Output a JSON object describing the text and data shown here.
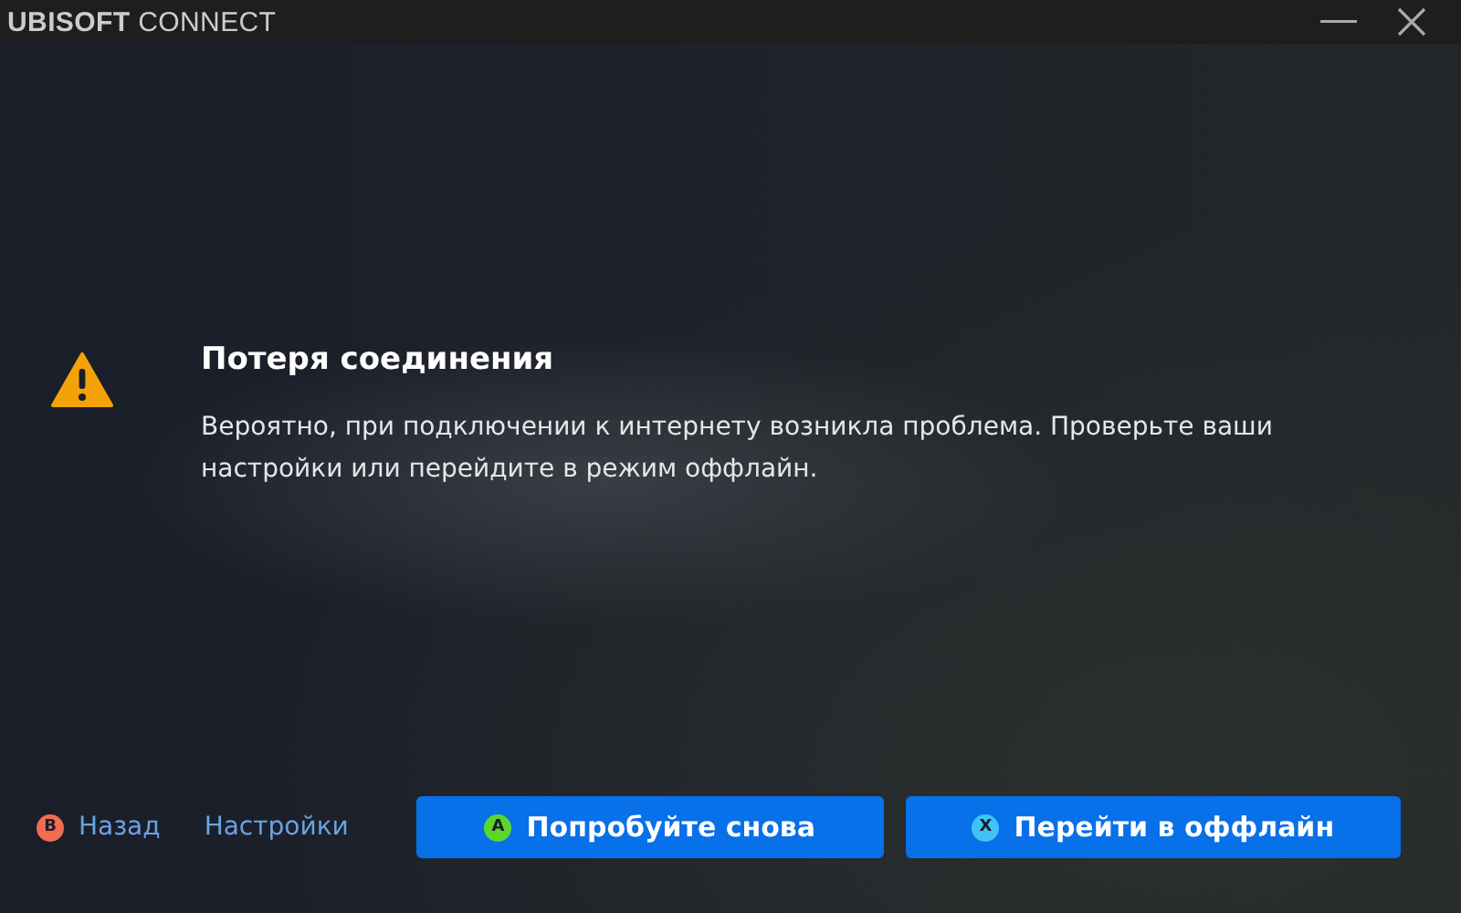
{
  "window": {
    "title_bold": "UBISOFT",
    "title_rest": "CONNECT"
  },
  "dialog": {
    "title": "Потеря соединения",
    "message": "Вероятно, при подключении к интернету возникла проблема. Проверьте ваши настройки или перейдите в режим оффлайн."
  },
  "footer": {
    "links": [
      {
        "glyph": "B",
        "color": "#f26d4f",
        "label": "Назад"
      },
      {
        "label": "Настройки"
      }
    ],
    "buttons": [
      {
        "glyph": "A",
        "color": "#5ad82a",
        "label": "Попробуйте снова"
      },
      {
        "glyph": "X",
        "color": "#3fc3f5",
        "label": "Перейти в оффлайн"
      }
    ]
  }
}
